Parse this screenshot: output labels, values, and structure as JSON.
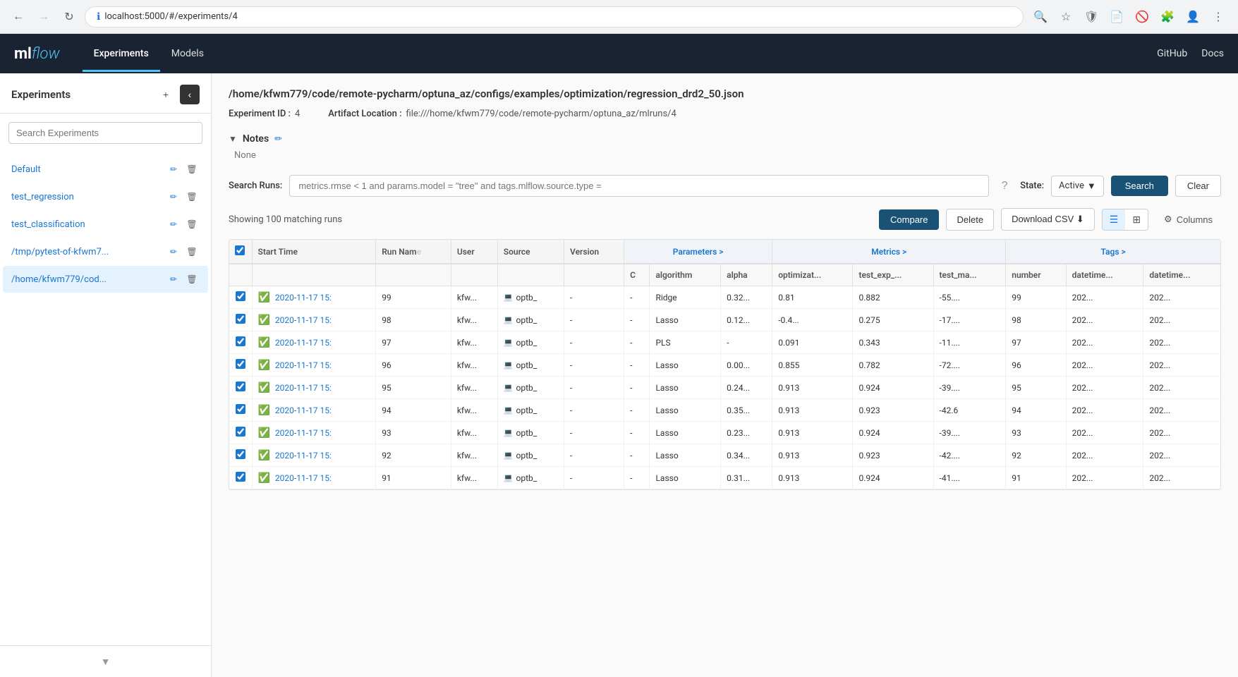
{
  "browser": {
    "url": "localhost:5000/#/experiments/4",
    "back_disabled": false,
    "forward_disabled": true
  },
  "header": {
    "logo_ml": "ml",
    "logo_flow": "flow",
    "nav": [
      {
        "label": "Experiments",
        "active": true
      },
      {
        "label": "Models",
        "active": false
      }
    ],
    "right_links": [
      {
        "label": "GitHub"
      },
      {
        "label": "Docs"
      }
    ]
  },
  "sidebar": {
    "title": "Experiments",
    "search_placeholder": "Search Experiments",
    "items": [
      {
        "name": "Default",
        "active": false
      },
      {
        "name": "test_regression",
        "active": false
      },
      {
        "name": "test_classification",
        "active": false
      },
      {
        "name": "/tmp/pytest-of-kfwm7...",
        "active": false
      },
      {
        "name": "/home/kfwm779/cod...",
        "active": true
      }
    ]
  },
  "experiment": {
    "path": "/home/kfwm779/code/remote-pycharm/optuna_az/configs/examples/optimization/regression_drd2_50.json",
    "id_label": "Experiment ID :",
    "id_value": "4",
    "artifact_label": "Artifact Location :",
    "artifact_value": "file:///home/kfwm779/code/remote-pycharm/optuna_az/mlruns/4",
    "notes_title": "Notes",
    "notes_content": "None",
    "search_runs_label": "Search Runs:",
    "search_placeholder": "metrics.rmse < 1 and params.model = \"tree\" and tags.mlflow.source.type =",
    "state_label": "State:",
    "state_value": "Active",
    "search_btn": "Search",
    "clear_btn": "Clear",
    "showing_text": "Showing 100 matching runs",
    "compare_btn": "Compare",
    "delete_btn": "Delete",
    "csv_btn": "Download CSV",
    "columns_btn": "Columns"
  },
  "table": {
    "columns": [
      "",
      "Start Time",
      "Run Name",
      "User",
      "Source",
      "Version",
      "C",
      "algorithm",
      "alpha",
      "optimize_",
      "test_exp_",
      "test_ma_",
      "number",
      "datetime_",
      "datetime_2"
    ],
    "group_params": "Parameters >",
    "group_metrics": "Metrics >",
    "group_tags": "Tags >",
    "rows": [
      {
        "checked": true,
        "start_time": "2020-11-17 15:",
        "run_name": "99",
        "user": "kfw...",
        "source": "optb_",
        "version": "-",
        "c": "-",
        "algorithm": "Ridge",
        "alpha": "0.32...",
        "optimize": "0.81",
        "test_exp": "0.882",
        "test_ma": "-55....",
        "number": "99",
        "dt1": "202...",
        "dt2": "202..."
      },
      {
        "checked": true,
        "start_time": "2020-11-17 15:",
        "run_name": "98",
        "user": "kfw...",
        "source": "optb_",
        "version": "-",
        "c": "-",
        "algorithm": "Lasso",
        "alpha": "0.12...",
        "optimize": "-0.4...",
        "test_exp": "0.275",
        "test_ma": "-17....",
        "number": "98",
        "dt1": "202...",
        "dt2": "202..."
      },
      {
        "checked": true,
        "start_time": "2020-11-17 15:",
        "run_name": "97",
        "user": "kfw...",
        "source": "optb_",
        "version": "-",
        "c": "-",
        "algorithm": "PLS",
        "alpha": "-",
        "optimize": "0.091",
        "test_exp": "0.343",
        "test_ma": "-11....",
        "number": "97",
        "dt1": "202...",
        "dt2": "202..."
      },
      {
        "checked": true,
        "start_time": "2020-11-17 15:",
        "run_name": "96",
        "user": "kfw...",
        "source": "optb_",
        "version": "-",
        "c": "-",
        "algorithm": "Lasso",
        "alpha": "0.00...",
        "optimize": "0.855",
        "test_exp": "0.782",
        "test_ma": "-72....",
        "number": "96",
        "dt1": "202...",
        "dt2": "202..."
      },
      {
        "checked": true,
        "start_time": "2020-11-17 15:",
        "run_name": "95",
        "user": "kfw...",
        "source": "optb_",
        "version": "-",
        "c": "-",
        "algorithm": "Lasso",
        "alpha": "0.24...",
        "optimize": "0.913",
        "test_exp": "0.924",
        "test_ma": "-39....",
        "number": "95",
        "dt1": "202...",
        "dt2": "202..."
      },
      {
        "checked": true,
        "start_time": "2020-11-17 15:",
        "run_name": "94",
        "user": "kfw...",
        "source": "optb_",
        "version": "-",
        "c": "-",
        "algorithm": "Lasso",
        "alpha": "0.35...",
        "optimize": "0.913",
        "test_exp": "0.923",
        "test_ma": "-42.6",
        "number": "94",
        "dt1": "202...",
        "dt2": "202..."
      },
      {
        "checked": true,
        "start_time": "2020-11-17 15:",
        "run_name": "93",
        "user": "kfw...",
        "source": "optb_",
        "version": "-",
        "c": "-",
        "algorithm": "Lasso",
        "alpha": "0.23...",
        "optimize": "0.913",
        "test_exp": "0.924",
        "test_ma": "-39....",
        "number": "93",
        "dt1": "202...",
        "dt2": "202..."
      },
      {
        "checked": true,
        "start_time": "2020-11-17 15:",
        "run_name": "92",
        "user": "kfw...",
        "source": "optb_",
        "version": "-",
        "c": "-",
        "algorithm": "Lasso",
        "alpha": "0.34...",
        "optimize": "0.913",
        "test_exp": "0.923",
        "test_ma": "-42....",
        "number": "92",
        "dt1": "202...",
        "dt2": "202..."
      },
      {
        "checked": true,
        "start_time": "2020-11-17 15:",
        "run_name": "91",
        "user": "kfw...",
        "source": "optb_",
        "version": "-",
        "c": "-",
        "algorithm": "Lasso",
        "alpha": "0.31...",
        "optimize": "0.913",
        "test_exp": "0.924",
        "test_ma": "-41....",
        "number": "91",
        "dt1": "202...",
        "dt2": "202..."
      }
    ]
  }
}
